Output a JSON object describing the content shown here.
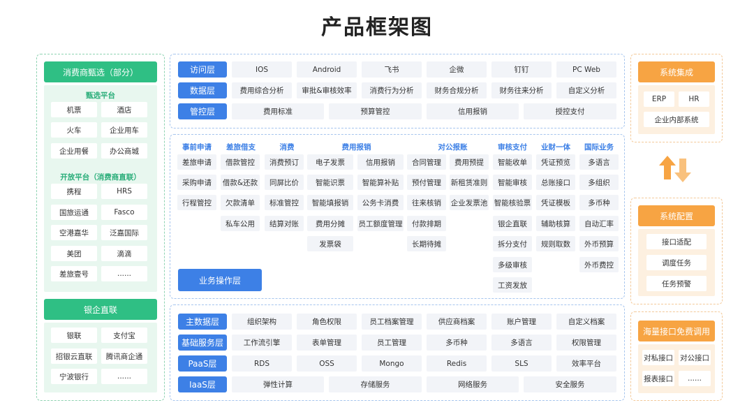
{
  "title": "产品框架图",
  "left": {
    "section1": {
      "header": "消费商甄选（部分）",
      "sub1_title": "甄选平台",
      "sub1_items": [
        "机票",
        "酒店",
        "火车",
        "企业用车",
        "企业用餐",
        "办公商城"
      ],
      "sub2_title": "开放平台（消费商直联）",
      "sub2_items": [
        "携程",
        "HRS",
        "国旅运通",
        "Fasco",
        "空港嘉华",
        "泛嘉国际",
        "美团",
        "滴滴",
        "差旅壹号",
        "......"
      ]
    },
    "section2": {
      "header": "银企直联",
      "items": [
        "银联",
        "支付宝",
        "招银云直联",
        "腾讯商企通",
        "宁波银行",
        "......"
      ]
    }
  },
  "top": {
    "rows": [
      {
        "label": "访问层",
        "items": [
          "IOS",
          "Android",
          "飞书",
          "企微",
          "钉钉",
          "PC Web"
        ]
      },
      {
        "label": "数据层",
        "items": [
          "费用综合分析",
          "审批&审核效率",
          "消费行为分析",
          "财务合规分析",
          "财务往来分析",
          "自定义分析"
        ]
      },
      {
        "label": "管控层",
        "items": [
          "费用标准",
          "预算管控",
          "信用报销",
          "授控支付"
        ]
      }
    ]
  },
  "middle": {
    "label": "业务操作层",
    "columns": [
      {
        "head": "事前申请",
        "items": [
          "差旅申请",
          "采购申请",
          "行程管控"
        ]
      },
      {
        "head": "差旅借支",
        "items": [
          "借款管控",
          "借款&还款",
          "欠款清单",
          "私车公用"
        ]
      },
      {
        "head": "消费",
        "items": [
          "消费预订",
          "同屏比价",
          "标准管控",
          "结算对账"
        ]
      },
      {
        "head": "费用报销",
        "items": [
          "电子发票",
          "信用报销",
          "智能识票",
          "智能算补贴",
          "智能填报销",
          "公务卡消费",
          "费用分摊",
          "员工额度管理",
          "发票袋"
        ]
      },
      {
        "head": "对公报账",
        "items": [
          "合同管理",
          "费用预提",
          "预付管理",
          "新租赁准则",
          "往来核销",
          "企业发票池",
          "付款排期",
          "长期待摊"
        ]
      },
      {
        "head": "审核支付",
        "items": [
          "智能收单",
          "智能审核",
          "智能核验票",
          "银企直联",
          "拆分支付",
          "多级审核",
          "工资发放"
        ]
      },
      {
        "head": "业财一体",
        "items": [
          "凭证预览",
          "总账接口",
          "凭证模板",
          "辅助核算",
          "规则取数"
        ]
      },
      {
        "head": "国际业务",
        "items": [
          "多语言",
          "多组织",
          "多币种",
          "自动汇率",
          "外币预算",
          "外币费控"
        ]
      }
    ]
  },
  "bottom": {
    "rows": [
      {
        "label": "主数据层",
        "items": [
          "组织架构",
          "角色权限",
          "员工档案管理",
          "供应商档案",
          "账户管理",
          "自定义档案"
        ]
      },
      {
        "label": "基础服务层",
        "items": [
          "工作流引擎",
          "表单管理",
          "员工管理",
          "多币种",
          "多语言",
          "权限管理"
        ]
      },
      {
        "label": "PaaS层",
        "items": [
          "RDS",
          "OSS",
          "Mongo",
          "Redis",
          "SLS",
          "效率平台"
        ]
      },
      {
        "label": "IaaS层",
        "items": [
          "弹性计算",
          "存储服务",
          "网络服务",
          "安全服务"
        ]
      }
    ]
  },
  "right": {
    "integration": {
      "header": "系统集成",
      "items": [
        "ERP",
        "HR",
        "企业内部系统"
      ]
    },
    "config": {
      "header": "系统配置",
      "items": [
        "接口适配",
        "调度任务",
        "任务预警"
      ]
    },
    "api": {
      "header": "海量接口免费调用",
      "items": [
        "对私接口",
        "对公接口",
        "报表接口",
        "......"
      ]
    }
  },
  "colors": {
    "green": "#2fbf84",
    "blue": "#3d80e6",
    "orange": "#f7a443"
  },
  "icons": {
    "exchange": "up-down-arrows-icon"
  }
}
